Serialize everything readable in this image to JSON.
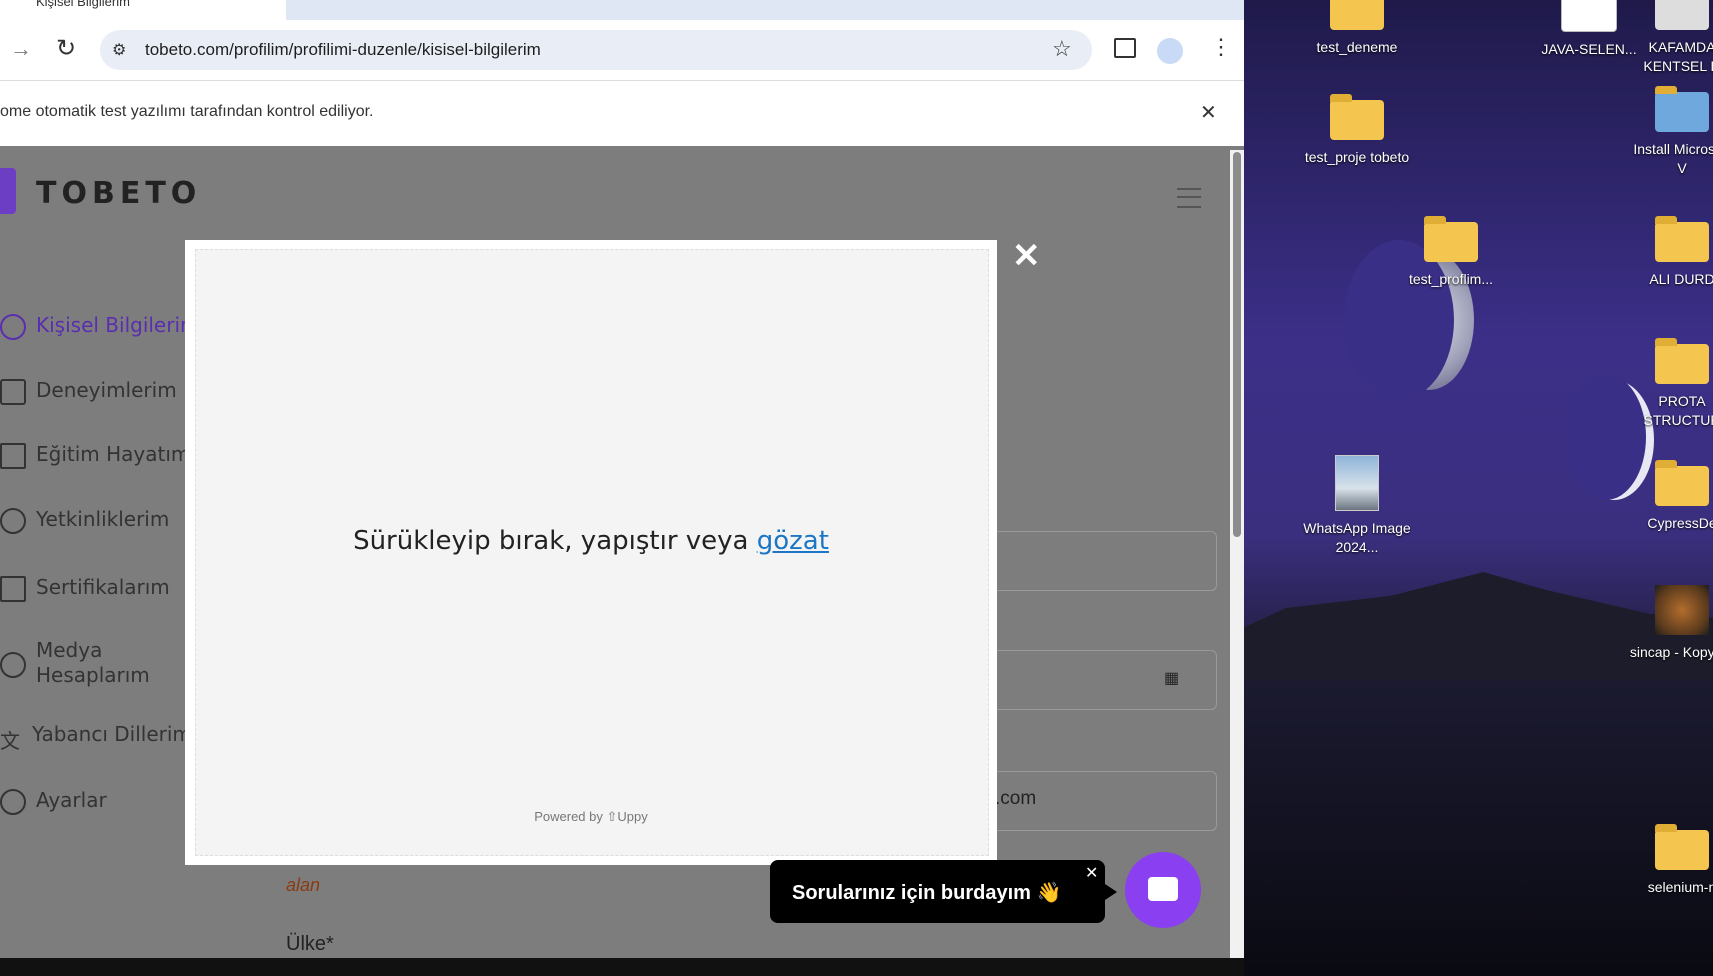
{
  "browser": {
    "tab_title": "Kişisel Bilgilerim",
    "url": "tobeto.com/profilim/profilimi-duzenle/kisisel-bilgilerim",
    "infobar_text": "ome otomatik test yazılımı tarafından kontrol ediliyor."
  },
  "site": {
    "logo_text": "TOBETO",
    "sidebar": [
      {
        "label": "Kişisel Bilgilerim",
        "active": true
      },
      {
        "label": "Deneyimlerim",
        "active": false
      },
      {
        "label": "Eğitim Hayatım",
        "active": false
      },
      {
        "label": "Yetkinliklerim",
        "active": false
      },
      {
        "label": "Sertifikalarım",
        "active": false
      },
      {
        "label": "Medya Hesaplarım",
        "active": false
      },
      {
        "label": "Yabancı Dillerim",
        "active": false
      },
      {
        "label": "Ayarlar",
        "active": false
      }
    ],
    "email_suffix": ".com",
    "note_text": "alan",
    "country_label": "Ülke*"
  },
  "modal": {
    "drop_text": "Sürükleyip bırak, yapıştır veya",
    "browse_link": "gözat",
    "powered_by": "Powered by",
    "brand": "Uppy"
  },
  "chat": {
    "bubble_text": "Sorularınız için burdayım 👋",
    "accent": "#8a3ff0"
  },
  "desktop": {
    "icons": [
      {
        "label": "test_deneme"
      },
      {
        "label": "JAVA-SELEN..."
      },
      {
        "label": "KAFAMDA KENTSEL D"
      },
      {
        "label": "test_proje tobeto"
      },
      {
        "label": "Install Microsoft V"
      },
      {
        "label": "test_proflim..."
      },
      {
        "label": "ALI DURD"
      },
      {
        "label": "PROTA STRUCTUR"
      },
      {
        "label": "WhatsApp Image 2024..."
      },
      {
        "label": "CypressDe"
      },
      {
        "label": "sincap - Kopya..."
      },
      {
        "label": "selenium-n"
      }
    ]
  }
}
